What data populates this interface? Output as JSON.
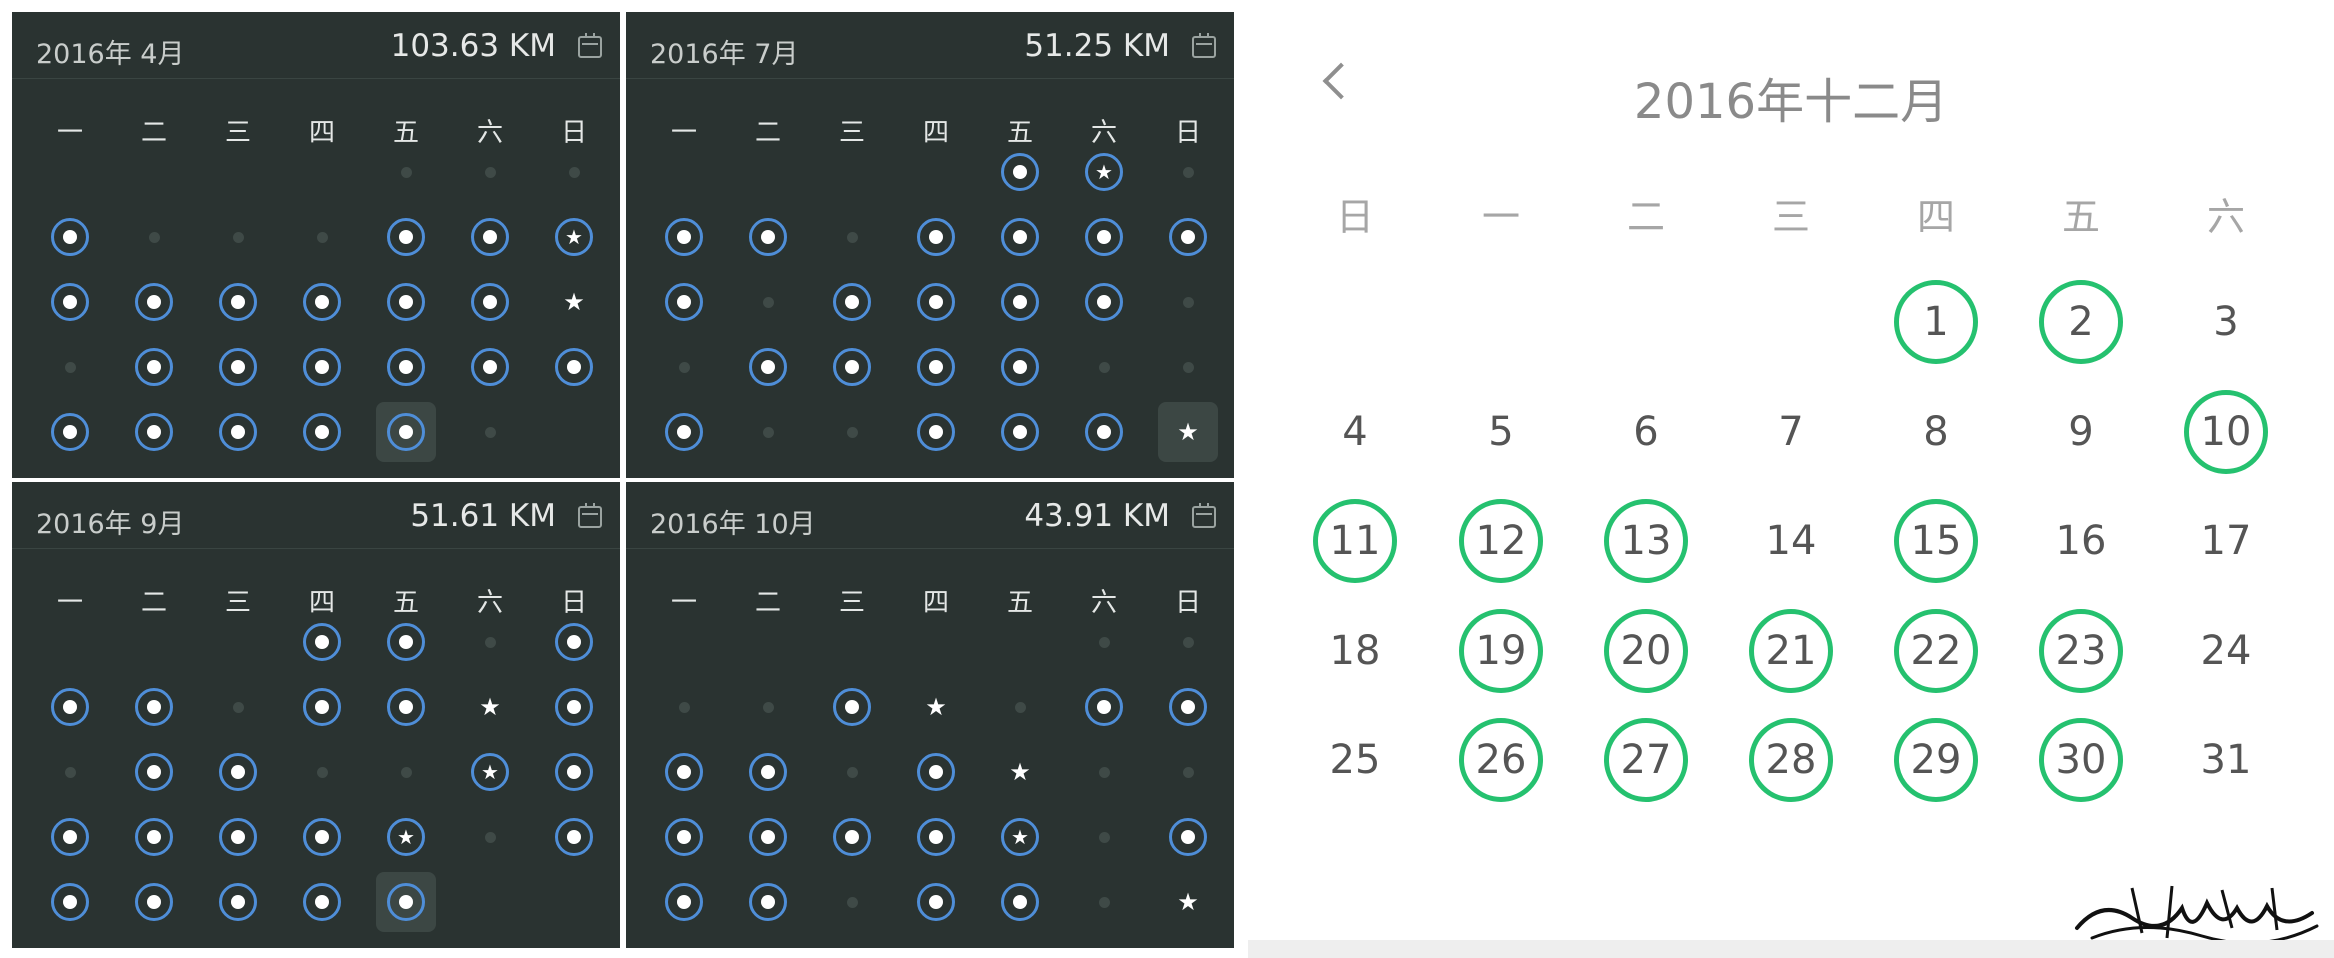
{
  "weekdays_mon_first": [
    "一",
    "二",
    "三",
    "四",
    "五",
    "六",
    "日"
  ],
  "weekdays_sun_first": [
    "日",
    "一",
    "二",
    "三",
    "四",
    "五",
    "六"
  ],
  "panels": [
    {
      "month_label": "2016年 4月",
      "distance": "103.63 KM",
      "rows": [
        [
          "empty",
          "empty",
          "empty",
          "empty",
          "dot",
          "dot",
          "dot"
        ],
        [
          "ring",
          "dot",
          "dot",
          "dot",
          "ring",
          "ring",
          "ring-star"
        ],
        [
          "ring",
          "ring",
          "ring",
          "ring",
          "ring",
          "ring",
          "star"
        ],
        [
          "dot",
          "ring",
          "ring",
          "ring",
          "ring",
          "ring",
          "ring"
        ],
        [
          "ring",
          "ring",
          "ring",
          "ring",
          "ring-today",
          "dot",
          "empty"
        ]
      ]
    },
    {
      "month_label": "2016年 7月",
      "distance": "51.25 KM",
      "rows": [
        [
          "empty",
          "empty",
          "empty",
          "empty",
          "ring",
          "ring-star",
          "dot"
        ],
        [
          "ring",
          "ring",
          "dot",
          "ring",
          "ring",
          "ring",
          "ring"
        ],
        [
          "ring",
          "dot",
          "ring",
          "ring",
          "ring",
          "ring",
          "dot"
        ],
        [
          "dot",
          "ring",
          "ring",
          "ring",
          "ring",
          "dot",
          "dot"
        ],
        [
          "ring",
          "dot",
          "dot",
          "ring",
          "ring",
          "ring",
          "star-today"
        ]
      ]
    },
    {
      "month_label": "2016年 9月",
      "distance": "51.61 KM",
      "rows": [
        [
          "empty",
          "empty",
          "empty",
          "ring",
          "ring",
          "dot",
          "ring"
        ],
        [
          "ring",
          "ring",
          "dot",
          "ring",
          "ring",
          "star",
          "ring"
        ],
        [
          "dot",
          "ring",
          "ring",
          "dot",
          "dot",
          "ring-star",
          "ring"
        ],
        [
          "ring",
          "ring",
          "ring",
          "ring",
          "ring-star",
          "dot",
          "ring"
        ],
        [
          "ring",
          "ring",
          "ring",
          "ring",
          "ring-today",
          "empty",
          "empty"
        ]
      ]
    },
    {
      "month_label": "2016年 10月",
      "distance": "43.91 KM",
      "rows": [
        [
          "empty",
          "empty",
          "empty",
          "empty",
          "empty",
          "dot",
          "dot"
        ],
        [
          "dot",
          "dot",
          "ring",
          "star",
          "dot",
          "ring",
          "ring"
        ],
        [
          "ring",
          "ring",
          "dot",
          "ring",
          "star",
          "dot",
          "dot"
        ],
        [
          "ring",
          "ring",
          "ring",
          "ring",
          "ring-star",
          "dot",
          "ring"
        ],
        [
          "ring",
          "ring",
          "dot",
          "ring",
          "ring",
          "dot",
          "star"
        ]
      ]
    }
  ],
  "december": {
    "title": "2016年十二月",
    "days": [
      [
        "",
        "",
        "",
        "",
        "1",
        "2",
        "3"
      ],
      [
        "4",
        "5",
        "6",
        "7",
        "8",
        "9",
        "10"
      ],
      [
        "11",
        "12",
        "13",
        "14",
        "15",
        "16",
        "17"
      ],
      [
        "18",
        "19",
        "20",
        "21",
        "22",
        "23",
        "24"
      ],
      [
        "25",
        "26",
        "27",
        "28",
        "29",
        "30",
        "31"
      ]
    ],
    "completed_days": [
      1,
      2,
      10,
      11,
      12,
      13,
      15,
      19,
      20,
      21,
      22,
      23,
      26,
      27,
      28,
      29,
      30
    ]
  },
  "colors": {
    "panel_bg": "#2a3331",
    "ring_blue": "#4f8ed8",
    "done_green": "#25c16f"
  }
}
